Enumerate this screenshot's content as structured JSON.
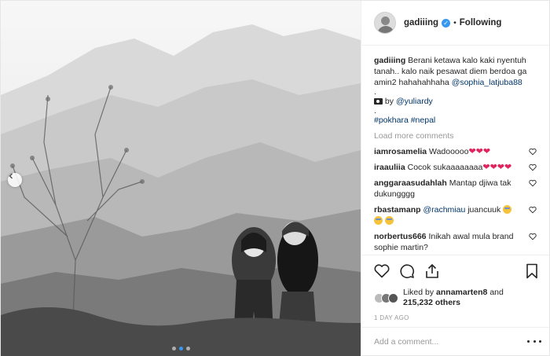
{
  "post": {
    "author": "gadiiing",
    "separator": "•",
    "follow_status": "Following",
    "caption": {
      "username": "gadiiing",
      "text": "Berani ketawa kalo kaki nyentuh tanah.. kalo naik pesawat diem berdoa ga amin2 hahahahhaha",
      "mention": "@sophia_latjuba88",
      "dot1": ".",
      "credit_prefix": "by",
      "credit_mention": "@yuliardy",
      "dot2": ".",
      "hashtag1": "#pokhara",
      "hashtag2": "#nepal"
    },
    "load_more": "Load more comments",
    "comments": [
      {
        "username": "iamrosamelia",
        "text": "Wadooooo",
        "emoji": "❤❤❤"
      },
      {
        "username": "iraauliia",
        "text": "Cocok sukaaaaaaaa",
        "emoji": "❤❤❤❤"
      },
      {
        "username": "anggaraasudahlah",
        "text": "Mantap djiwa tak dukungggg",
        "emoji": ""
      },
      {
        "username": "rbastamanp",
        "mention": "@rachmiau",
        "text": "juancuuk",
        "emoji": ""
      },
      {
        "username": "norbertus666",
        "text": "Inikah awal mula brand sophie martin?",
        "emoji": ""
      }
    ],
    "likes": {
      "prefix": "Liked by",
      "user": "annamarten8",
      "and": "and",
      "count": "215,232 others"
    },
    "time": "1 DAY AGO",
    "add_comment_placeholder": "Add a comment...",
    "icons": {
      "like": "heart-icon",
      "comment": "comment-icon",
      "share": "share-icon",
      "save": "bookmark-icon",
      "prev": "chevron-left-icon",
      "more": "more-options-icon",
      "verified": "verified-badge-icon"
    },
    "colors": {
      "link": "#003569",
      "verified": "#3897f0",
      "heart": "#e0245e",
      "muted": "#999999",
      "text": "#262626"
    },
    "carousel": {
      "slide_count": 3,
      "active_slide": 2
    }
  }
}
